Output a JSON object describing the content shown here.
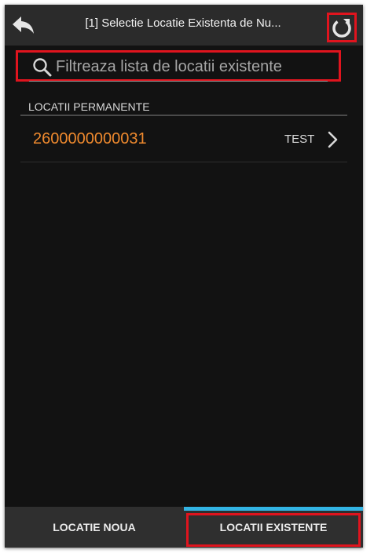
{
  "header": {
    "title": "[1] Selectie Locatie Existenta de Nu...",
    "back_icon": "back-arrow-icon",
    "refresh_icon": "refresh-icon"
  },
  "search": {
    "placeholder": "Filtreaza lista de locatii existente",
    "value": "",
    "icon": "search-icon"
  },
  "list": {
    "section_label": "LOCATII PERMANENTE",
    "items": [
      {
        "id": "2600000000031",
        "tag": "TEST"
      }
    ]
  },
  "tabs": {
    "left_label": "LOCATIE NOUA",
    "right_label": "LOCATII EXISTENTE",
    "active": "right"
  },
  "colors": {
    "accent_orange": "#f08a2e",
    "active_tab_indicator": "#33b5e5",
    "highlight_red": "#e0141e"
  }
}
